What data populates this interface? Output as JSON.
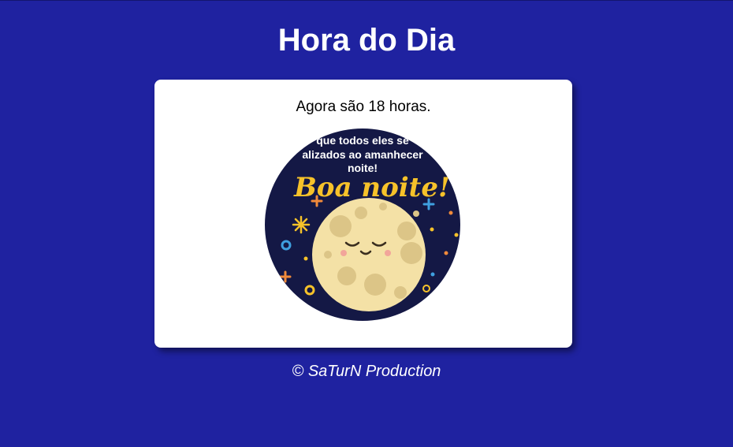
{
  "header": {
    "title": "Hora do Dia"
  },
  "card": {
    "message": "Agora são 18 horas.",
    "image": {
      "icon": "moon-good-night-icon",
      "caption_lines": [
        "que todos eles se",
        "alizados ao amanhecer",
        "noite!"
      ],
      "greeting": "Boa noite!"
    }
  },
  "footer": {
    "text": "© SaTurN Production"
  },
  "colors": {
    "background": "#1f22a0",
    "card": "#ffffff",
    "image_background": "#141845",
    "moon": "#f4e1a6",
    "greeting": "#f6c22a"
  }
}
